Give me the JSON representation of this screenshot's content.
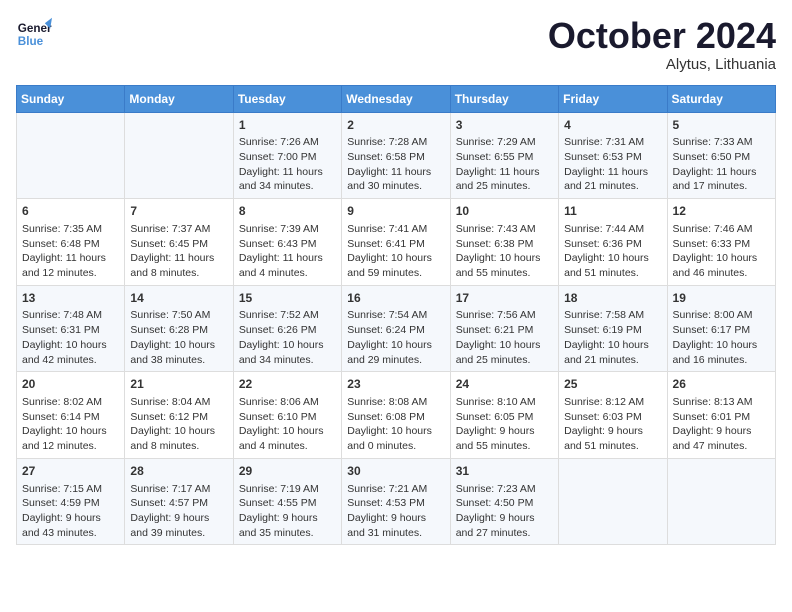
{
  "logo": {
    "name_part1": "General",
    "name_part2": "Blue"
  },
  "title": "October 2024",
  "location": "Alytus, Lithuania",
  "days_header": [
    "Sunday",
    "Monday",
    "Tuesday",
    "Wednesday",
    "Thursday",
    "Friday",
    "Saturday"
  ],
  "weeks": [
    [
      {
        "day": "",
        "content": ""
      },
      {
        "day": "",
        "content": ""
      },
      {
        "day": "1",
        "content": "Sunrise: 7:26 AM\nSunset: 7:00 PM\nDaylight: 11 hours\nand 34 minutes."
      },
      {
        "day": "2",
        "content": "Sunrise: 7:28 AM\nSunset: 6:58 PM\nDaylight: 11 hours\nand 30 minutes."
      },
      {
        "day": "3",
        "content": "Sunrise: 7:29 AM\nSunset: 6:55 PM\nDaylight: 11 hours\nand 25 minutes."
      },
      {
        "day": "4",
        "content": "Sunrise: 7:31 AM\nSunset: 6:53 PM\nDaylight: 11 hours\nand 21 minutes."
      },
      {
        "day": "5",
        "content": "Sunrise: 7:33 AM\nSunset: 6:50 PM\nDaylight: 11 hours\nand 17 minutes."
      }
    ],
    [
      {
        "day": "6",
        "content": "Sunrise: 7:35 AM\nSunset: 6:48 PM\nDaylight: 11 hours\nand 12 minutes."
      },
      {
        "day": "7",
        "content": "Sunrise: 7:37 AM\nSunset: 6:45 PM\nDaylight: 11 hours\nand 8 minutes."
      },
      {
        "day": "8",
        "content": "Sunrise: 7:39 AM\nSunset: 6:43 PM\nDaylight: 11 hours\nand 4 minutes."
      },
      {
        "day": "9",
        "content": "Sunrise: 7:41 AM\nSunset: 6:41 PM\nDaylight: 10 hours\nand 59 minutes."
      },
      {
        "day": "10",
        "content": "Sunrise: 7:43 AM\nSunset: 6:38 PM\nDaylight: 10 hours\nand 55 minutes."
      },
      {
        "day": "11",
        "content": "Sunrise: 7:44 AM\nSunset: 6:36 PM\nDaylight: 10 hours\nand 51 minutes."
      },
      {
        "day": "12",
        "content": "Sunrise: 7:46 AM\nSunset: 6:33 PM\nDaylight: 10 hours\nand 46 minutes."
      }
    ],
    [
      {
        "day": "13",
        "content": "Sunrise: 7:48 AM\nSunset: 6:31 PM\nDaylight: 10 hours\nand 42 minutes."
      },
      {
        "day": "14",
        "content": "Sunrise: 7:50 AM\nSunset: 6:28 PM\nDaylight: 10 hours\nand 38 minutes."
      },
      {
        "day": "15",
        "content": "Sunrise: 7:52 AM\nSunset: 6:26 PM\nDaylight: 10 hours\nand 34 minutes."
      },
      {
        "day": "16",
        "content": "Sunrise: 7:54 AM\nSunset: 6:24 PM\nDaylight: 10 hours\nand 29 minutes."
      },
      {
        "day": "17",
        "content": "Sunrise: 7:56 AM\nSunset: 6:21 PM\nDaylight: 10 hours\nand 25 minutes."
      },
      {
        "day": "18",
        "content": "Sunrise: 7:58 AM\nSunset: 6:19 PM\nDaylight: 10 hours\nand 21 minutes."
      },
      {
        "day": "19",
        "content": "Sunrise: 8:00 AM\nSunset: 6:17 PM\nDaylight: 10 hours\nand 16 minutes."
      }
    ],
    [
      {
        "day": "20",
        "content": "Sunrise: 8:02 AM\nSunset: 6:14 PM\nDaylight: 10 hours\nand 12 minutes."
      },
      {
        "day": "21",
        "content": "Sunrise: 8:04 AM\nSunset: 6:12 PM\nDaylight: 10 hours\nand 8 minutes."
      },
      {
        "day": "22",
        "content": "Sunrise: 8:06 AM\nSunset: 6:10 PM\nDaylight: 10 hours\nand 4 minutes."
      },
      {
        "day": "23",
        "content": "Sunrise: 8:08 AM\nSunset: 6:08 PM\nDaylight: 10 hours\nand 0 minutes."
      },
      {
        "day": "24",
        "content": "Sunrise: 8:10 AM\nSunset: 6:05 PM\nDaylight: 9 hours\nand 55 minutes."
      },
      {
        "day": "25",
        "content": "Sunrise: 8:12 AM\nSunset: 6:03 PM\nDaylight: 9 hours\nand 51 minutes."
      },
      {
        "day": "26",
        "content": "Sunrise: 8:13 AM\nSunset: 6:01 PM\nDaylight: 9 hours\nand 47 minutes."
      }
    ],
    [
      {
        "day": "27",
        "content": "Sunrise: 7:15 AM\nSunset: 4:59 PM\nDaylight: 9 hours\nand 43 minutes."
      },
      {
        "day": "28",
        "content": "Sunrise: 7:17 AM\nSunset: 4:57 PM\nDaylight: 9 hours\nand 39 minutes."
      },
      {
        "day": "29",
        "content": "Sunrise: 7:19 AM\nSunset: 4:55 PM\nDaylight: 9 hours\nand 35 minutes."
      },
      {
        "day": "30",
        "content": "Sunrise: 7:21 AM\nSunset: 4:53 PM\nDaylight: 9 hours\nand 31 minutes."
      },
      {
        "day": "31",
        "content": "Sunrise: 7:23 AM\nSunset: 4:50 PM\nDaylight: 9 hours\nand 27 minutes."
      },
      {
        "day": "",
        "content": ""
      },
      {
        "day": "",
        "content": ""
      }
    ]
  ]
}
